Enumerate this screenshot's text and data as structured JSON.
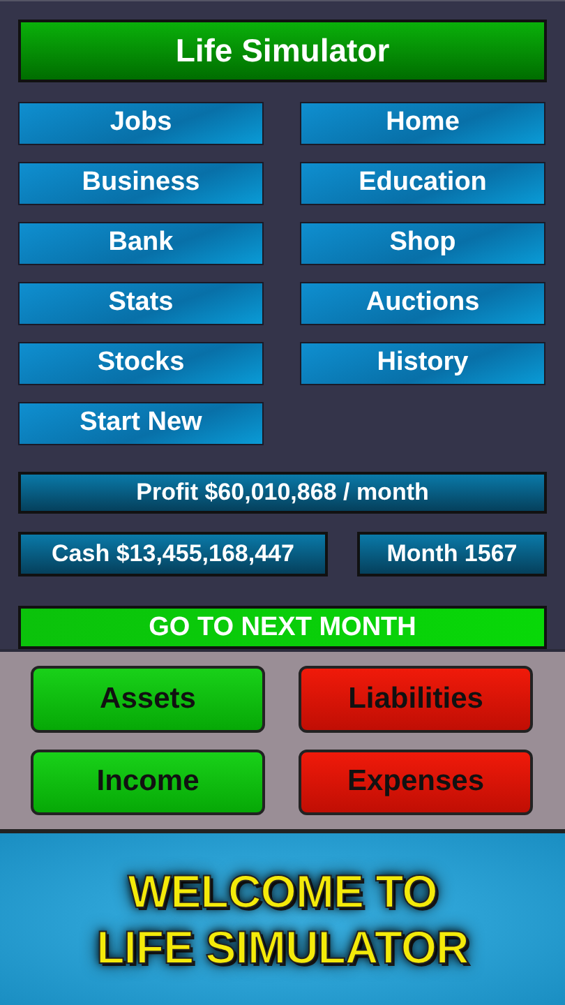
{
  "title": "Life Simulator",
  "menu": [
    {
      "label": "Jobs"
    },
    {
      "label": "Home"
    },
    {
      "label": "Business"
    },
    {
      "label": "Education"
    },
    {
      "label": "Bank"
    },
    {
      "label": "Shop"
    },
    {
      "label": "Stats"
    },
    {
      "label": "Auctions"
    },
    {
      "label": "Stocks"
    },
    {
      "label": "History"
    },
    {
      "label": "Start New"
    }
  ],
  "profit": "Profit $60,010,868 / month",
  "cash": "Cash $13,455,168,447",
  "month": "Month 1567",
  "next_button": "GO TO NEXT MONTH",
  "finance": [
    {
      "label": "Assets",
      "kind": "positive"
    },
    {
      "label": "Liabilities",
      "kind": "negative"
    },
    {
      "label": "Income",
      "kind": "positive"
    },
    {
      "label": "Expenses",
      "kind": "negative"
    }
  ],
  "banner": {
    "lines": [
      "WELCOME TO",
      "LIFE SIMULATOR"
    ]
  }
}
